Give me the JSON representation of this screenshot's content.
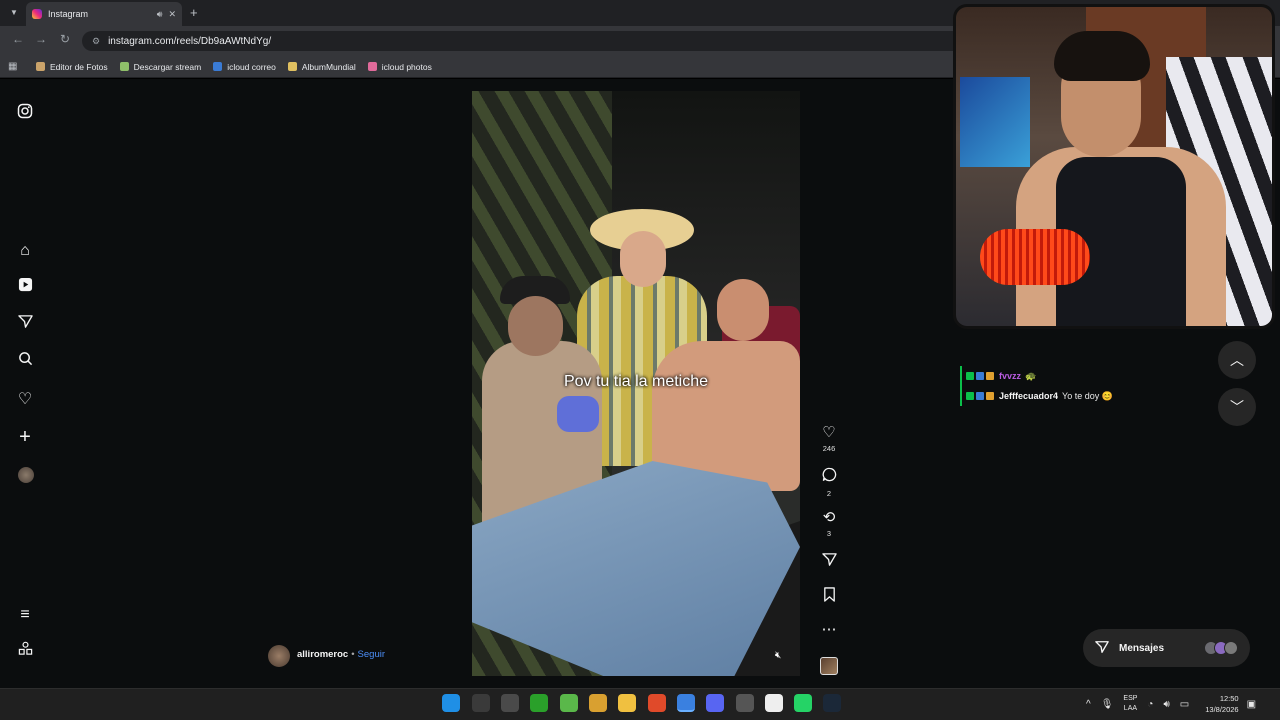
{
  "browser": {
    "tab_title": "Instagram",
    "url": "instagram.com/reels/Db9aAWtNdYg/",
    "bookmarks": [
      {
        "label": "Editor de Fotos",
        "color": "#caa36a"
      },
      {
        "label": "Descargar stream",
        "color": "#8fbf6a"
      },
      {
        "label": "icloud correo",
        "color": "#3a7bd5"
      },
      {
        "label": "AlbumMundial",
        "color": "#e0c060"
      },
      {
        "label": "icloud photos",
        "color": "#e06a9a"
      }
    ]
  },
  "sidebar": {
    "icons": [
      "instagram-icon",
      "home-icon",
      "reels-icon",
      "send-icon",
      "search-icon",
      "heart-icon",
      "plus-icon",
      "profile-avatar",
      "menu-icon",
      "apps-icon"
    ]
  },
  "reel": {
    "caption": "Pov tu tia la metiche",
    "username": "alliromeroc",
    "separator": "•",
    "follow_label": "Seguir",
    "likes": "246",
    "comments": "2",
    "reposts": "3"
  },
  "chat": {
    "lines": [
      {
        "user": "fvvzz",
        "message": "",
        "user_color": "#b85ce0",
        "trailing": "🐢"
      },
      {
        "user": "Jefffecuador4",
        "message": "Yo te doy 😊",
        "user_color": "#f5f5f5",
        "trailing": ""
      }
    ],
    "accent": "#0bbf4a"
  },
  "messages_button": {
    "label": "Mensajes"
  },
  "taskbar": {
    "language_top": "ESP",
    "language_bottom": "LAA",
    "time": "12:50",
    "date": "13/8/2026"
  }
}
